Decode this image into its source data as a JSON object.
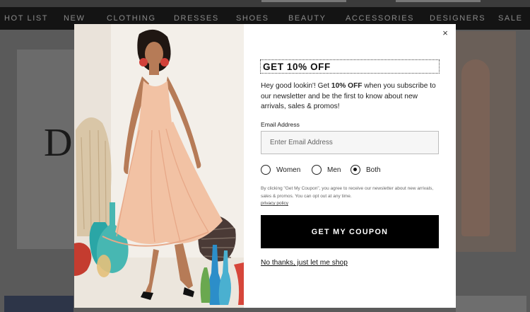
{
  "nav": {
    "items": [
      "HOT LIST",
      "NEW",
      "CLOTHING",
      "DRESSES",
      "SHOES",
      "BEAUTY",
      "ACCESSORIES",
      "DESIGNERS",
      "SALE"
    ]
  },
  "background": {
    "hero_letter": "D"
  },
  "modal": {
    "close_label": "×",
    "headline": "GET 10% OFF",
    "intro": {
      "part1": "Hey good lookin'! Get ",
      "bold": "10% OFF",
      "part2": " when you subscribe to our newsletter and be the first to know about new arrivals, sales & promos!"
    },
    "email": {
      "label": "Email Address",
      "placeholder": "Enter Email Address",
      "value": ""
    },
    "gender": {
      "options": [
        "Women",
        "Men",
        "Both"
      ],
      "selected": "Both"
    },
    "legal": {
      "text": "By clicking \"Get My Coupon\", you agree to receive our newsletter about new arrivals, sales & promos. You can opt out at any time.",
      "link": "privacy policy"
    },
    "cta_label": "GET MY COUPON",
    "dismiss_label": "No thanks, just let me shop"
  },
  "colors": {
    "overlay_bg": "#5e5e5e",
    "nav_bg": "#141414",
    "cta_bg": "#000000",
    "modal_bg": "#ffffff",
    "dress": "#f2c2a4"
  }
}
